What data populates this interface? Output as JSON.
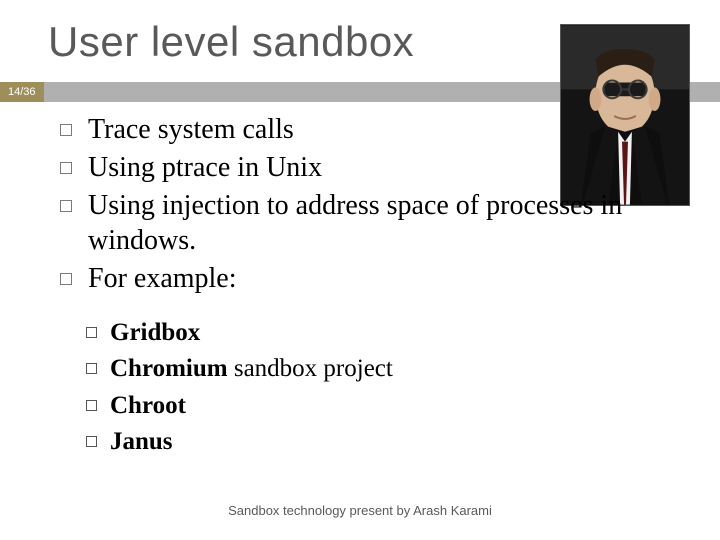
{
  "slide": {
    "title": "User level sandbox",
    "page": "14/36",
    "bullets": [
      "Trace system calls",
      "Using ptrace in Unix",
      "Using injection to address space of processes in windows.",
      "For example:"
    ],
    "sub_bullets": [
      {
        "bold": "Gridbox",
        "tail": ""
      },
      {
        "bold": "Chromium",
        "tail": " sandbox project"
      },
      {
        "bold": "Chroot",
        "tail": ""
      },
      {
        "bold": "Janus",
        "tail": ""
      }
    ],
    "footer": "Sandbox technology present by Arash Karami"
  }
}
